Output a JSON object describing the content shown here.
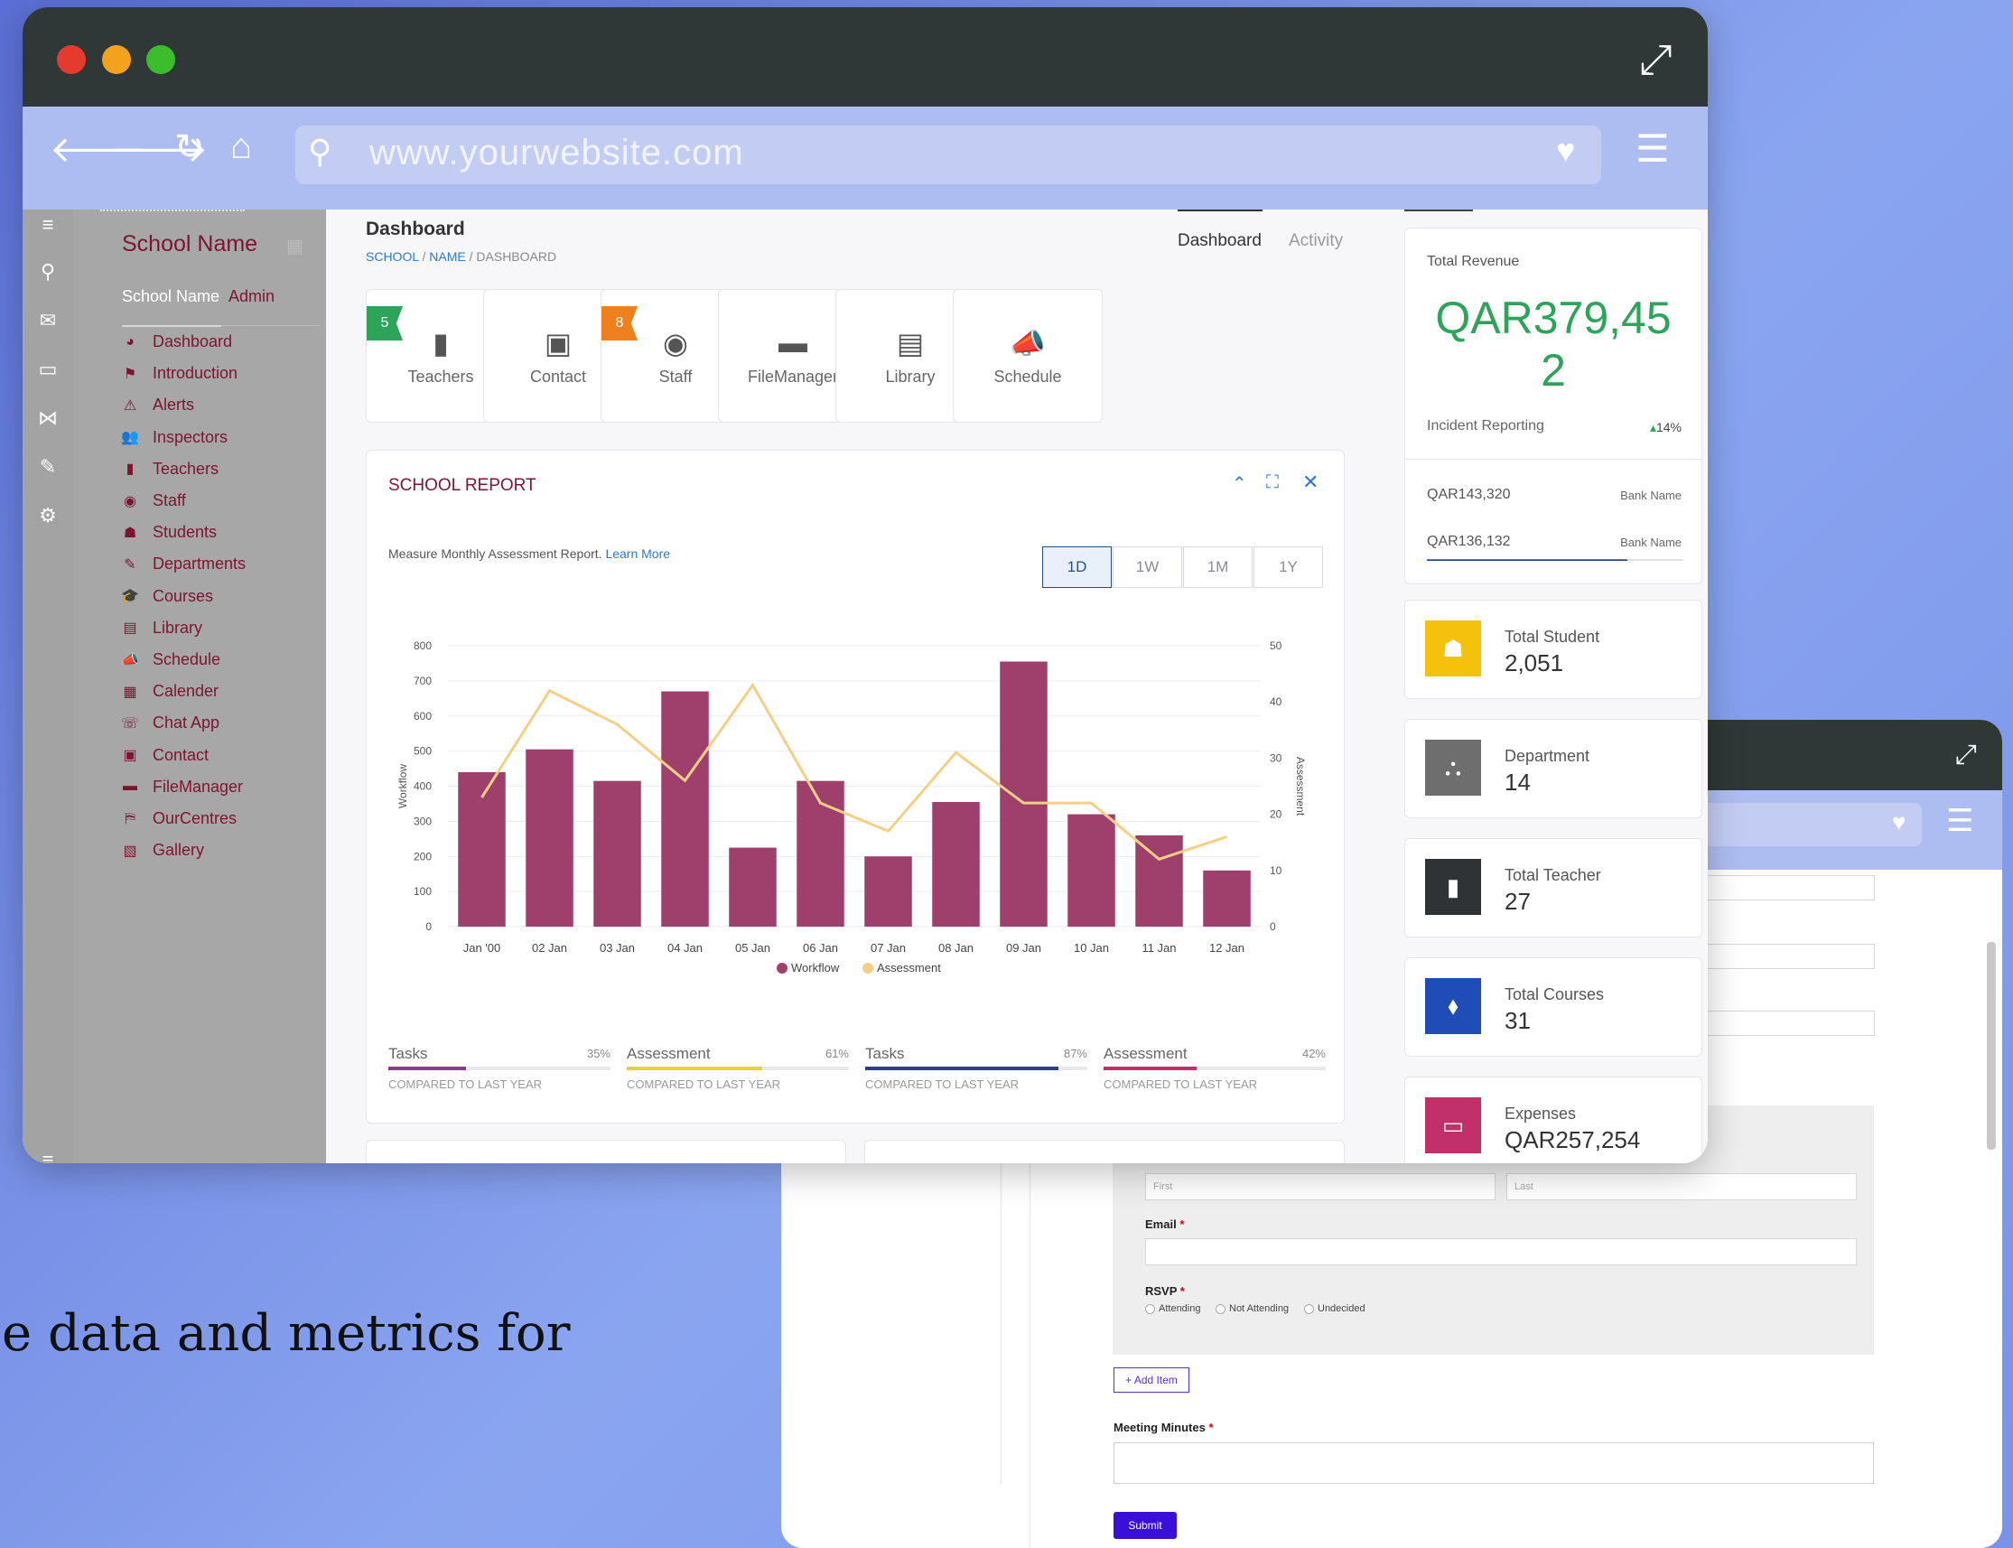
{
  "browser": {
    "url": "www.yourwebsite.com"
  },
  "sidebar": {
    "school_name": "School Name",
    "user_name": "School Name",
    "user_role": "Admin",
    "items": [
      {
        "label": "Dashboard",
        "icon": "dashboard-icon"
      },
      {
        "label": "Introduction",
        "icon": "flag-icon"
      },
      {
        "label": "Alerts",
        "icon": "alert-icon"
      },
      {
        "label": "Inspectors",
        "icon": "users-icon"
      },
      {
        "label": "Teachers",
        "icon": "teacher-icon"
      },
      {
        "label": "Staff",
        "icon": "user-circle-icon"
      },
      {
        "label": "Students",
        "icon": "students-icon"
      },
      {
        "label": "Departments",
        "icon": "edit-icon"
      },
      {
        "label": "Courses",
        "icon": "graduation-cap-icon"
      },
      {
        "label": "Library",
        "icon": "book-icon"
      },
      {
        "label": "Schedule",
        "icon": "megaphone-icon"
      },
      {
        "label": "Calender",
        "icon": "calendar-icon"
      },
      {
        "label": "Chat App",
        "icon": "chat-icon"
      },
      {
        "label": "Contact",
        "icon": "contact-icon"
      },
      {
        "label": "FileManager",
        "icon": "folder-icon"
      },
      {
        "label": "OurCentres",
        "icon": "map-icon"
      },
      {
        "label": "Gallery",
        "icon": "image-icon"
      }
    ]
  },
  "header": {
    "title": "Dashboard",
    "breadcrumb": [
      "SCHOOL",
      "NAME",
      "DASHBOARD"
    ],
    "tabs": [
      "Dashboard",
      "Activity"
    ]
  },
  "tiles": [
    {
      "label": "Teachers",
      "badge": "5",
      "icon": "teacher-icon"
    },
    {
      "label": "Contact",
      "badge": "",
      "icon": "contact-icon"
    },
    {
      "label": "Staff",
      "badge": "8",
      "icon": "user-circle-icon"
    },
    {
      "label": "FileManager",
      "badge": "",
      "icon": "folder-icon"
    },
    {
      "label": "Library",
      "badge": "",
      "icon": "book-icon"
    },
    {
      "label": "Schedule",
      "badge": "",
      "icon": "megaphone-icon"
    }
  ],
  "report": {
    "title": "SCHOOL REPORT",
    "description": "Measure Monthly Assessment Report.",
    "learn_more": "Learn More",
    "ranges": [
      "1D",
      "1W",
      "1M",
      "1Y"
    ],
    "selected_range": "1D",
    "stats": [
      {
        "name": "Tasks",
        "pct": "35%",
        "value": 0.35,
        "compare": "COMPARED TO LAST YEAR",
        "color": "#8e3b8f"
      },
      {
        "name": "Assessment",
        "pct": "61%",
        "value": 0.61,
        "compare": "COMPARED TO LAST YEAR",
        "color": "#e8d23a"
      },
      {
        "name": "Tasks",
        "pct": "87%",
        "value": 0.87,
        "compare": "COMPARED TO LAST YEAR",
        "color": "#2a3f8f"
      },
      {
        "name": "Assessment",
        "pct": "42%",
        "value": 0.42,
        "compare": "COMPARED TO LAST YEAR",
        "color": "#c2306a"
      }
    ]
  },
  "chart_data": {
    "type": "bar",
    "categories": [
      "Jan '00",
      "02 Jan",
      "03 Jan",
      "04 Jan",
      "05 Jan",
      "06 Jan",
      "07 Jan",
      "08 Jan",
      "09 Jan",
      "10 Jan",
      "11 Jan",
      "12 Jan"
    ],
    "series": [
      {
        "name": "Workflow",
        "type": "bar",
        "axis": "left",
        "color": "#9e3f6c",
        "values": [
          440,
          505,
          415,
          670,
          225,
          415,
          200,
          355,
          755,
          320,
          260,
          160
        ]
      },
      {
        "name": "Assessment",
        "type": "line",
        "axis": "right",
        "color": "#f5cf86",
        "values": [
          23,
          42,
          36,
          26,
          43,
          22,
          17,
          31,
          22,
          22,
          12,
          16
        ]
      }
    ],
    "xlabel": "",
    "ylabel": "Workflow",
    "y2label": "Assessment",
    "ylim": [
      0,
      800
    ],
    "y2lim": [
      0,
      50
    ],
    "yticks": [
      0,
      100,
      200,
      300,
      400,
      500,
      600,
      700,
      800
    ],
    "y2ticks": [
      0,
      10,
      20,
      30,
      40,
      50
    ],
    "grid": true,
    "legend": "bottom"
  },
  "revenue": {
    "label": "Total Revenue",
    "value_line1": "QAR379,45",
    "value_line2": "2",
    "sub_label": "Incident Reporting",
    "change": "14%",
    "banks": [
      {
        "amount": "QAR143,320",
        "name": "Bank Name"
      },
      {
        "amount": "QAR136,132",
        "name": "Bank Name"
      }
    ]
  },
  "kpis": [
    {
      "title": "Total Student",
      "value": "2,051",
      "color": "#f4c20d",
      "icon": "students-icon"
    },
    {
      "title": "Department",
      "value": "14",
      "color": "#6e6e6e",
      "icon": "sitemap-icon"
    },
    {
      "title": "Total Teacher",
      "value": "27",
      "color": "#2f3335",
      "icon": "teacher-icon"
    },
    {
      "title": "Total Courses",
      "value": "31",
      "color": "#1f4db8",
      "icon": "tag-icon"
    },
    {
      "title": "Expenses",
      "value": "QAR257,254",
      "color": "#c2306a",
      "icon": "credit-card-icon"
    }
  ],
  "back_form": {
    "name_first_placeholder": "First",
    "name_last_placeholder": "Last",
    "email_label": "Email",
    "rsvp_label": "RSVP",
    "rsvp_options": [
      "Attending",
      "Not Attending",
      "Undecided"
    ],
    "add_item": "+ Add Item",
    "minutes_label": "Meeting Minutes",
    "submit": "Submit"
  },
  "tagline": "e data and metrics for",
  "colors": {
    "accent": "#7c1530",
    "revenue_green": "#2ea35a",
    "link_blue": "#2a7bd3"
  }
}
